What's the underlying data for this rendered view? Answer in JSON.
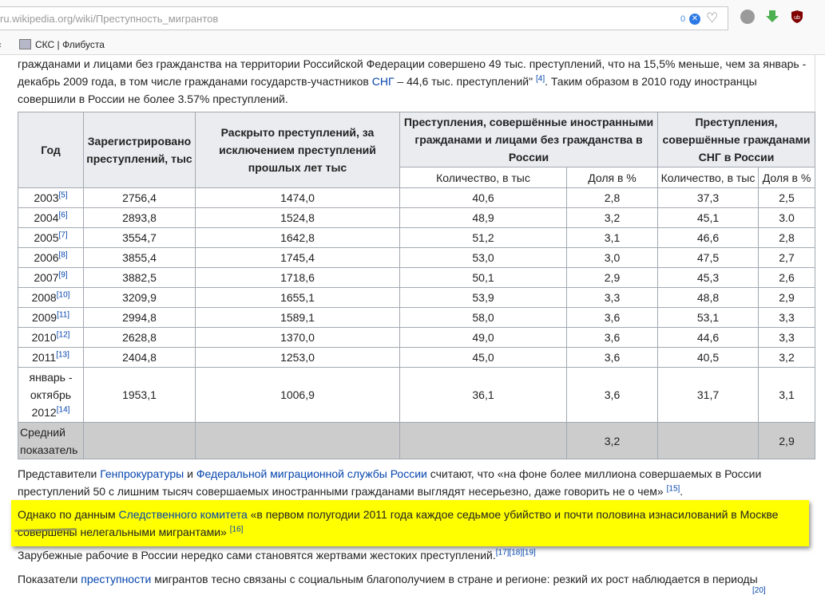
{
  "browser": {
    "url_domain": "ru.wikipedia.org",
    "url_path": "/wiki/Преступность_мигрантов",
    "badge_count": "0",
    "bookmark": "СКС | Флибуста",
    "icons": [
      "heart-icon",
      "globe-icon",
      "download-icon",
      "ublock-icon"
    ]
  },
  "intro": {
    "t1": "гражданами и лицами без гражданства на территории Российской Федерации совершено 49 тыс. преступлений, что на 15,5% меньше, чем за январь - декабрь 2009 года, в том числе гражданами государств-участников ",
    "link1": "СНГ",
    "t2": " – 44,6 тыс. преступлений\" ",
    "ref1": "[4]",
    "t3": ". Таким образом в 2010 году иностранцы совершили в России не более 3.57% преступлений."
  },
  "table": {
    "headers": {
      "year": "Год",
      "registered": "Зарегистрировано преступлений, тыс",
      "solved": "Раскрыто преступлений, за исключением преступлений прошлых лет тыс",
      "foreign": "Преступления, совершённые иностранными гражданами и лицами без гражданства в России",
      "cis": "Преступления, совершённые гражданами СНГ в России",
      "sub_qty": "Количество, в тыс",
      "sub_share": "Доля в %"
    },
    "rows": [
      {
        "year": "2003",
        "ref": "[5]",
        "reg": "2756,4",
        "solved": "1474,0",
        "f_qty": "40,6",
        "f_share": "2,8",
        "c_qty": "37,3",
        "c_share": "2,5"
      },
      {
        "year": "2004",
        "ref": "[6]",
        "reg": "2893,8",
        "solved": "1524,8",
        "f_qty": "48,9",
        "f_share": "3,2",
        "c_qty": "45,1",
        "c_share": "3.0"
      },
      {
        "year": "2005",
        "ref": "[7]",
        "reg": "3554,7",
        "solved": "1642,8",
        "f_qty": "51,2",
        "f_share": "3,1",
        "c_qty": "46,6",
        "c_share": "2,8"
      },
      {
        "year": "2006",
        "ref": "[8]",
        "reg": "3855,4",
        "solved": "1745,4",
        "f_qty": "53,0",
        "f_share": "3,0",
        "c_qty": "47,5",
        "c_share": "2,7"
      },
      {
        "year": "2007",
        "ref": "[9]",
        "reg": "3882,5",
        "solved": "1718,6",
        "f_qty": "50,1",
        "f_share": "2,9",
        "c_qty": "45,3",
        "c_share": "2,6"
      },
      {
        "year": "2008",
        "ref": "[10]",
        "reg": "3209,9",
        "solved": "1655,1",
        "f_qty": "53,9",
        "f_share": "3,3",
        "c_qty": "48,8",
        "c_share": "2,9"
      },
      {
        "year": "2009",
        "ref": "[11]",
        "reg": "2994,8",
        "solved": "1589,1",
        "f_qty": "58,0",
        "f_share": "3,6",
        "c_qty": "53,1",
        "c_share": "3,3"
      },
      {
        "year": "2010",
        "ref": "[12]",
        "reg": "2628,8",
        "solved": "1370,0",
        "f_qty": "49,0",
        "f_share": "3,6",
        "c_qty": "44,6",
        "c_share": "3,3"
      },
      {
        "year": "2011",
        "ref": "[13]",
        "reg": "2404,8",
        "solved": "1253,0",
        "f_qty": "45,0",
        "f_share": "3,6",
        "c_qty": "40,5",
        "c_share": "3,2"
      }
    ],
    "period_row": {
      "l1": "январь -",
      "l2": "октябрь",
      "l3": "2012",
      "ref": "[14]",
      "reg": "1953,1",
      "solved": "1006,9",
      "f_qty": "36,1",
      "f_share": "3,6",
      "c_qty": "31,7",
      "c_share": "3,1"
    },
    "avg_row": {
      "l1": "Средний",
      "l2": "показатель",
      "f_share": "3,2",
      "c_share": "2,9"
    }
  },
  "para2": {
    "t1": "Представители ",
    "link1": "Генпрокуратуры",
    "t2": " и ",
    "link2": "Федеральной миграционной службы России",
    "t3": " считают, что «на фоне более миллиона совершаемых в России преступлений 50 с лишним тысяч совершаемых иностранными гражданами выглядят несерьезно, даже говорить не о чем» ",
    "ref": "[15]",
    "t4": "."
  },
  "highlight": {
    "t1": "Однако по данным ",
    "link1": "Следственного комитета",
    "t2": " «в первом полугодии 2011 года каждое седьмое убийство и почти половина изнасилований в Москве совершены нелегальными мигрантами» ",
    "ref": "[16]",
    "color": "#ffff00"
  },
  "para3": {
    "t1": "Зарубежные рабочие в России нередко сами становятся жертвами жестоких преступлений.",
    "refs": "[17][18][19]"
  },
  "para4": {
    "t1": "Показатели ",
    "link1": "преступности",
    "t2": " мигрантов тесно связаны с социальным благополучием в стране и регионе: резкий их рост наблюдается в периоды",
    "ref_cut": "[20]"
  }
}
